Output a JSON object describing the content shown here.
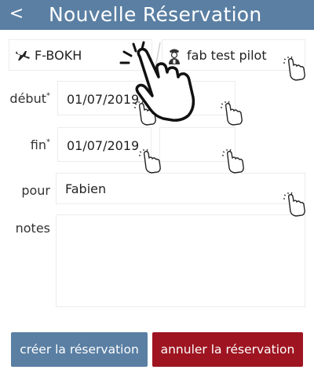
{
  "header": {
    "back_label": "<",
    "title": "Nouvelle Réservation"
  },
  "aircraft": {
    "value": "F-BOKH",
    "icon": "airplane-icon"
  },
  "pilot": {
    "value": "fab test pilot",
    "icon": "pilot-icon"
  },
  "fields": {
    "debut_label": "début",
    "debut_date": "01/07/2019",
    "debut_time": "",
    "fin_label": "fin",
    "fin_date": "01/07/2019",
    "fin_time": "",
    "required_mark": "*",
    "pour_label": "pour",
    "pour_value": "Fabien",
    "notes_label": "notes",
    "notes_value": ""
  },
  "buttons": {
    "create": "créer la réservation",
    "cancel": "annuler la réservation"
  },
  "colors": {
    "header": "#5a7fa3",
    "create_button": "#5a7fa3",
    "cancel_button": "#9e1521"
  }
}
